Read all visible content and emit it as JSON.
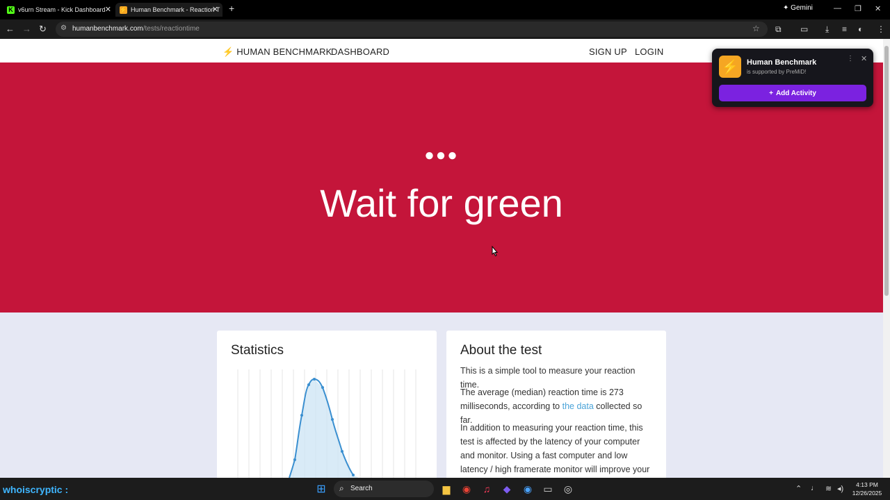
{
  "browser": {
    "tabs": [
      {
        "title": "v6urn Stream - Kick Dashboard",
        "active": false
      },
      {
        "title": "Human Benchmark - Reaction T",
        "active": true
      }
    ],
    "gemini_label": "Gemini",
    "url_host": "humanbenchmark.com",
    "url_path": "/tests/reactiontime"
  },
  "site": {
    "brand": "HUMAN BENCHMARK",
    "nav": {
      "dashboard": "DASHBOARD",
      "signup": "SIGN UP",
      "login": "LOGIN"
    },
    "hero": {
      "dots": "●●●",
      "title": "Wait for green"
    },
    "statistics": {
      "title": "Statistics"
    },
    "about": {
      "title": "About the test",
      "p1": "This is a simple tool to measure your reaction time.",
      "p2_before": "The average (median) reaction time is 273 milliseconds, according to ",
      "p2_link": "the data",
      "p2_after": " collected so far.",
      "p3": "In addition to measuring your reaction time, this test is affected by the latency of your computer and monitor. Using a fast computer and low latency / high framerate monitor will improve your score."
    }
  },
  "premid": {
    "title": "Human Benchmark",
    "subtitle": "is supported by PreMiD!",
    "button": "Add Activity"
  },
  "taskbar": {
    "overlay_name": "whoiscryptic :",
    "search_label": "Search",
    "time": "4:13 PM",
    "date": "12/26/2025"
  },
  "colors": {
    "hero_bg": "#c4153a",
    "page_bg": "#e6e8f4",
    "premid_button": "#7b22e0",
    "chart_line": "#3a8fd0"
  }
}
